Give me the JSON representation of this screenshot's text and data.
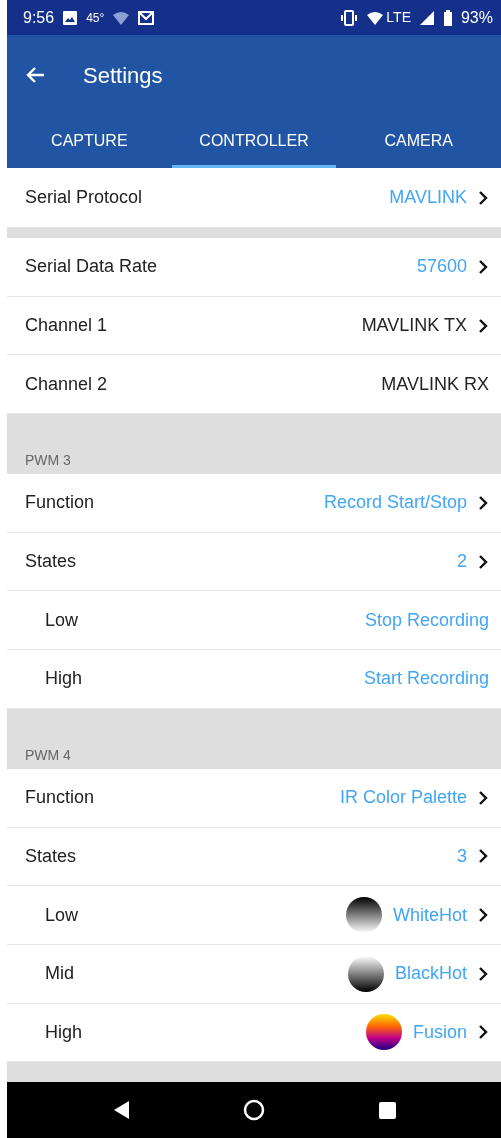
{
  "status_bar": {
    "time": "9:56",
    "temperature": "45°",
    "network": "LTE",
    "battery": "93%"
  },
  "app_bar": {
    "title": "Settings"
  },
  "tabs": [
    {
      "label": "CAPTURE",
      "selected": false
    },
    {
      "label": "CONTROLLER",
      "selected": true
    },
    {
      "label": "CAMERA",
      "selected": false
    }
  ],
  "sections": [
    {
      "rows": [
        {
          "kind": "setting",
          "label": "Serial Protocol",
          "value": "MAVLINK",
          "link": true,
          "chevron": true,
          "indented": false
        }
      ]
    },
    {
      "rows": [
        {
          "kind": "setting",
          "label": "Serial Data Rate",
          "value": "57600",
          "link": true,
          "chevron": true,
          "indented": false
        },
        {
          "kind": "setting",
          "label": "Channel 1",
          "value": "MAVLINK TX",
          "link": false,
          "chevron": true,
          "indented": false
        },
        {
          "kind": "setting",
          "label": "Channel 2",
          "value": "MAVLINK RX",
          "link": false,
          "chevron": false,
          "indented": false
        }
      ]
    },
    {
      "header": "PWM 3",
      "rows": [
        {
          "kind": "setting",
          "label": "Function",
          "value": "Record Start/Stop",
          "link": true,
          "chevron": true,
          "indented": false
        },
        {
          "kind": "setting",
          "label": "States",
          "value": "2",
          "link": true,
          "chevron": true,
          "indented": false
        },
        {
          "kind": "setting",
          "label": "Low",
          "value": "Stop Recording",
          "link": true,
          "chevron": false,
          "indented": true
        },
        {
          "kind": "setting",
          "label": "High",
          "value": "Start Recording",
          "link": true,
          "chevron": false,
          "indented": true
        }
      ]
    },
    {
      "header": "PWM 4",
      "rows": [
        {
          "kind": "setting",
          "label": "Function",
          "value": "IR Color Palette",
          "link": true,
          "chevron": true,
          "indented": false
        },
        {
          "kind": "setting",
          "label": "States",
          "value": "3",
          "link": true,
          "chevron": true,
          "indented": false
        },
        {
          "kind": "whitehot",
          "label": "Low",
          "value": "WhiteHot",
          "link": true,
          "chevron": true,
          "indented": true
        },
        {
          "kind": "blackhot",
          "label": "Mid",
          "value": "BlackHot",
          "link": true,
          "chevron": true,
          "indented": true
        },
        {
          "kind": "fusion",
          "label": "High",
          "value": "Fusion",
          "link": true,
          "chevron": true,
          "indented": true
        }
      ]
    }
  ]
}
